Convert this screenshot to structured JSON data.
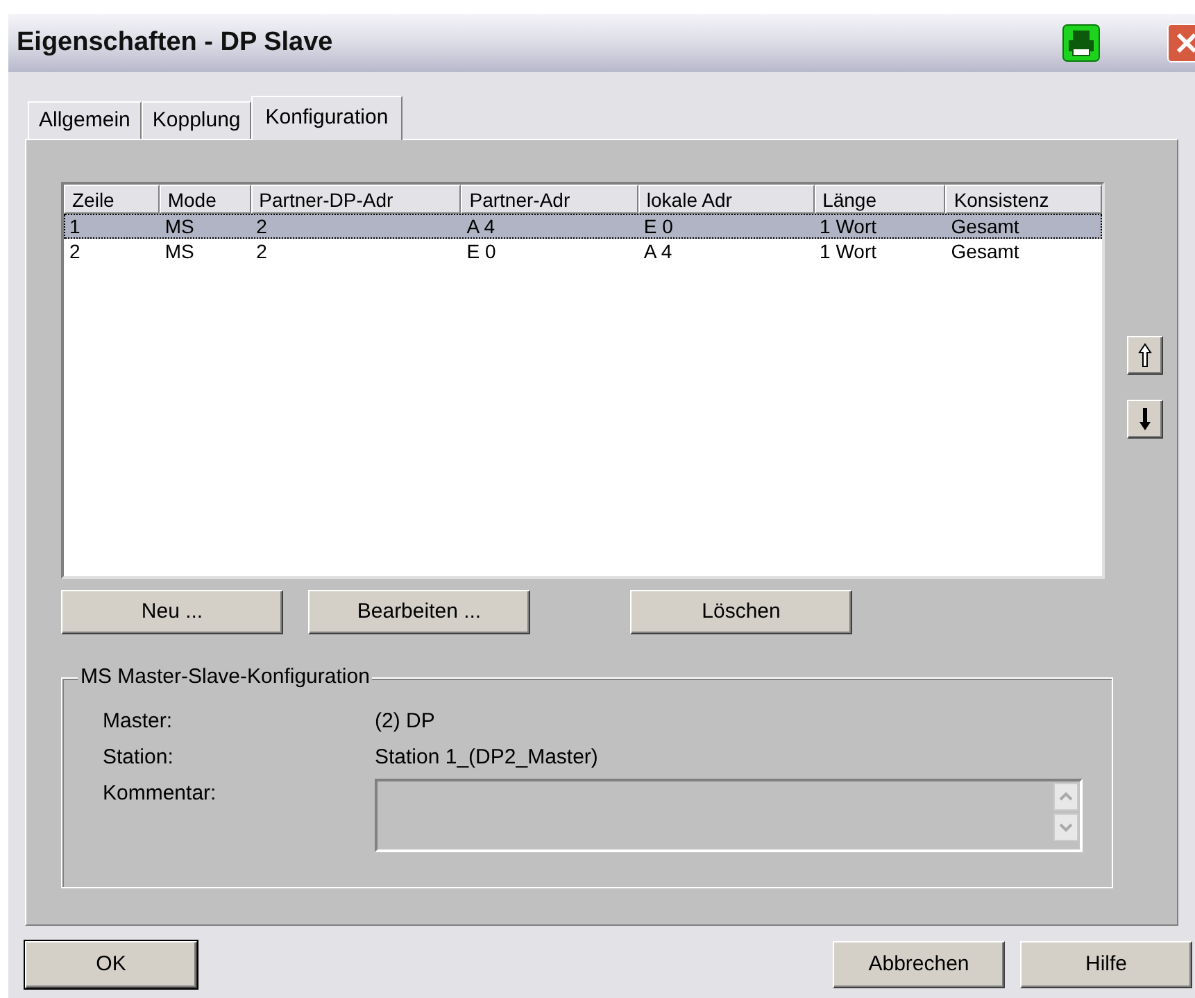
{
  "window": {
    "title": "Eigenschaften - DP Slave"
  },
  "tabs": [
    {
      "label": "Allgemein",
      "selected": false
    },
    {
      "label": "Kopplung",
      "selected": false
    },
    {
      "label": "Konfiguration",
      "selected": true
    }
  ],
  "table": {
    "columns": [
      "Zeile",
      "Mode",
      "Partner-DP-Adr",
      "Partner-Adr",
      "lokale Adr",
      "Länge",
      "Konsistenz"
    ],
    "rows": [
      {
        "cells": [
          "1",
          "MS",
          "2",
          "A 4",
          "E 0",
          "1 Wort",
          "Gesamt"
        ],
        "selected": true
      },
      {
        "cells": [
          "2",
          "MS",
          "2",
          "E 0",
          "A 4",
          "1 Wort",
          "Gesamt"
        ],
        "selected": false
      }
    ]
  },
  "table_buttons": [
    "Neu ...",
    "Bearbeiten ...",
    "Löschen"
  ],
  "group": {
    "title": "MS Master-Slave-Konfiguration",
    "fields": [
      {
        "label": "Master:",
        "value": "(2) DP"
      },
      {
        "label": "Station:",
        "value": "Station 1_(DP2_Master)"
      }
    ],
    "comment_label": "Kommentar:"
  },
  "footer": {
    "ok": "OK",
    "cancel": "Abbrechen",
    "help": "Hilfe"
  }
}
